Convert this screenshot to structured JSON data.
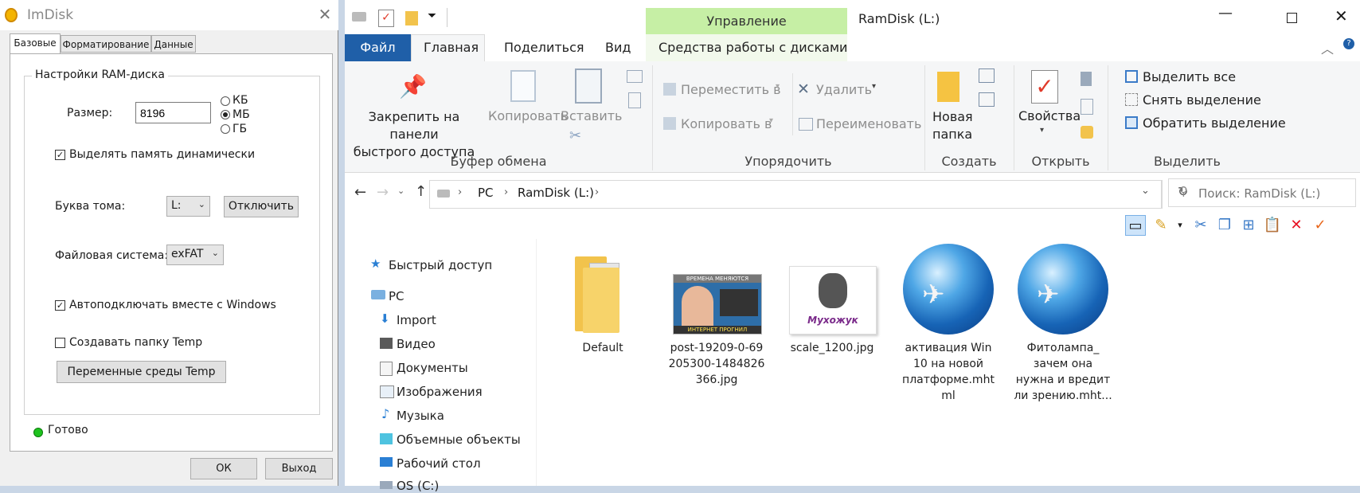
{
  "imdisk": {
    "title": "ImDisk",
    "tabs": [
      "Базовые",
      "Форматирование",
      "Данные"
    ],
    "group_title": "Настройки RAM-диска",
    "size_label": "Размер:",
    "size_value": "8196",
    "units": [
      {
        "label": "КБ",
        "selected": false
      },
      {
        "label": "МБ",
        "selected": true
      },
      {
        "label": "ГБ",
        "selected": false
      }
    ],
    "dynamic_label": "Выделять память динамически",
    "dynamic_checked": true,
    "letter_label": "Буква тома:",
    "letter_value": "L:",
    "detach_button": "Отключить",
    "fs_label": "Файловая система:",
    "fs_value": "exFAT",
    "autoconnect_label": "Автоподключать вместе с Windows",
    "autoconnect_checked": true,
    "temp_label": "Создавать папку Temp",
    "temp_checked": false,
    "env_button": "Переменные среды Temp",
    "status": "Готово",
    "ok_button": "ОК",
    "exit_button": "Выход"
  },
  "explorer": {
    "title": "RamDisk (L:)",
    "context_tab": "Управление",
    "menu": {
      "file": "Файл",
      "home": "Главная",
      "share": "Поделиться",
      "view": "Вид",
      "disk_tools": "Средства работы с дисками"
    },
    "ribbon": {
      "pin_line1": "Закрепить на панели",
      "pin_line2": "быстрого доступа",
      "copy": "Копировать",
      "paste": "Вставить",
      "move_to": "Переместить в",
      "copy_to": "Копировать в",
      "delete": "Удалить",
      "rename": "Переименовать",
      "new_folder_line1": "Новая",
      "new_folder_line2": "папка",
      "properties": "Свойства",
      "select_all": "Выделить все",
      "select_none": "Снять выделение",
      "invert_selection": "Обратить выделение",
      "groups": {
        "clipboard": "Буфер обмена",
        "organize": "Упорядочить",
        "new": "Создать",
        "open": "Открыть",
        "select": "Выделить"
      }
    },
    "breadcrumb": [
      "PC",
      "RamDisk (L:)"
    ],
    "search_placeholder": "Поиск: RamDisk (L:)",
    "tree": [
      "Быстрый доступ",
      "PC",
      "Import",
      "Видео",
      "Документы",
      "Изображения",
      "Музыка",
      "Объемные объекты",
      "Рабочий стол",
      "OS (C:)"
    ],
    "files": [
      {
        "line1": "Default",
        "line2": "",
        "line3": "",
        "line4": ""
      },
      {
        "line1": "post-19209-0-69",
        "line2": "205300-1484826",
        "line3": "366.jpg",
        "line4": ""
      },
      {
        "line1": "scale_1200.jpg",
        "line2": "",
        "line3": "",
        "line4": ""
      },
      {
        "line1": "активация Win",
        "line2": "10 на новой",
        "line3": "платформе.mht",
        "line4": "ml"
      },
      {
        "line1": "Фитолампа_",
        "line2": "зачем она",
        "line3": "нужна и вредит",
        "line4": "ли зрению.mht..."
      }
    ],
    "thumb_texts": {
      "meme_top": "ВРЕМЕНА МЕНЯЮТСЯ",
      "meme_bottom": "ИНТЕРНЕТ ПРОГНИЛ",
      "logo": "Мухожук"
    }
  },
  "colors": {
    "file_tab": "#1f5fa8",
    "context_tab": "#c6efa5",
    "status_ok": "#1ec21e",
    "delete_red": "#e81123"
  }
}
